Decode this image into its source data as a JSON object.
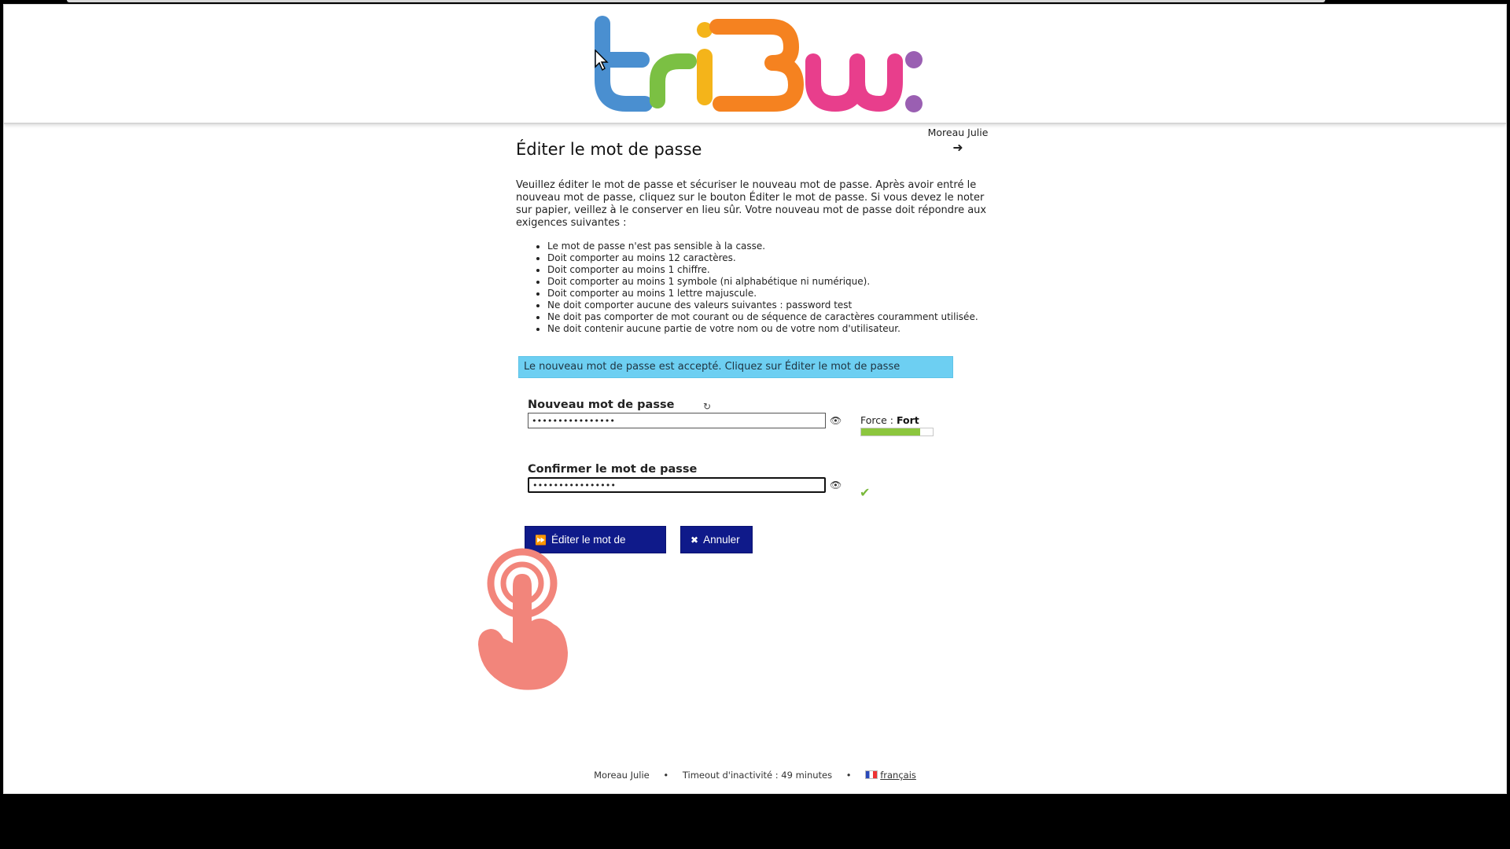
{
  "header": {
    "logo_alt": "tribu"
  },
  "user": {
    "name": "Moreau Julie",
    "logout_icon": "sign-out-icon"
  },
  "main": {
    "title": "Éditer le mot de passe",
    "intro": "Veuillez éditer le mot de passe et sécuriser le nouveau mot de passe. Après avoir entré le nouveau mot de passe, cliquez sur le bouton Éditer le mot de passe. Si vous devez le noter sur papier, veillez à le conserver en lieu sûr. Votre nouveau mot de passe doit répondre aux exigences suivantes :",
    "rules": [
      "Le mot de passe n'est pas sensible à la casse.",
      "Doit comporter au moins 12 caractères.",
      "Doit comporter au moins 1 chiffre.",
      "Doit comporter au moins 1 symbole (ni alphabétique ni numérique).",
      "Doit comporter au moins 1 lettre majuscule.",
      "Ne doit comporter aucune des valeurs suivantes : password test",
      "Ne doit pas comporter de mot courant ou de séquence de caractères couramment utilisée.",
      "Ne doit contenir aucune partie de votre nom ou de votre nom d'utilisateur."
    ],
    "notice": "Le nouveau mot de passe est accepté. Cliquez sur Éditer le mot de passe"
  },
  "form": {
    "new_password_label": "Nouveau mot de passe",
    "new_password_value": "••••••••••••••••",
    "confirm_password_label": "Confirmer le mot de passe",
    "confirm_password_value": "••••••••••••••••",
    "strength_label": "Force :",
    "strength_value": "Fort",
    "strength_level": 0.82,
    "submit_label": "Éditer le mot de passe",
    "cancel_label": "Annuler"
  },
  "footer": {
    "user": "Moreau Julie",
    "timeout": "Timeout d'inactivité : 49 minutes",
    "language": "français"
  },
  "colors": {
    "notice_bg": "#6dcff2",
    "button_bg": "#0f1a8a",
    "strength_fill": "#8cc63e"
  }
}
